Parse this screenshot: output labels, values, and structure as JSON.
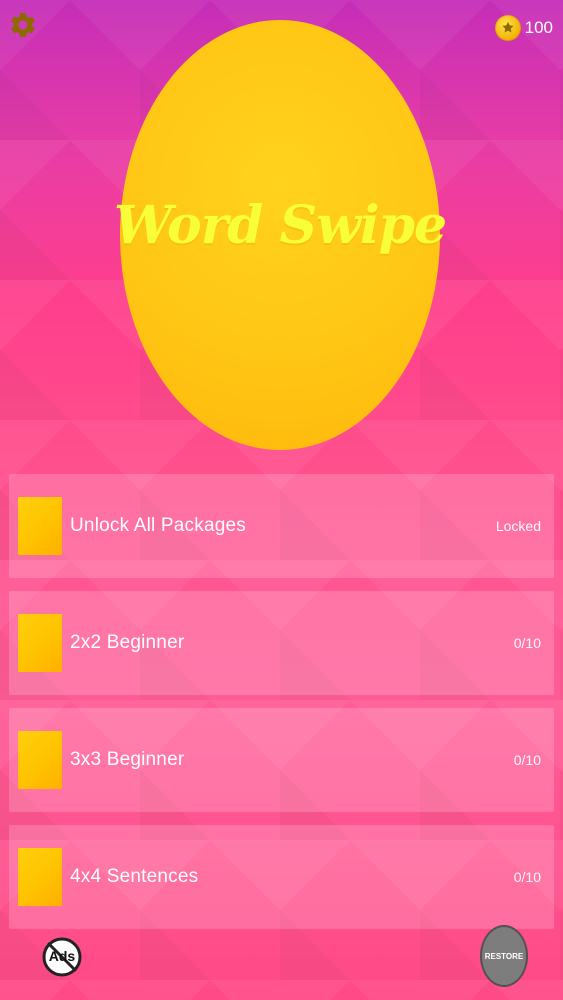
{
  "header": {
    "coins": "100"
  },
  "logo": {
    "title": "Word Swipe"
  },
  "packages": [
    {
      "label": "Unlock All Packages",
      "status": "Locked"
    },
    {
      "label": "2x2 Beginner",
      "status": "0/10"
    },
    {
      "label": "3x3 Beginner",
      "status": "0/10"
    },
    {
      "label": "4x4 Sentences",
      "status": "0/10"
    }
  ],
  "bottom": {
    "ads_label": "Ads",
    "restore_label": "RESTORE"
  },
  "icons": {
    "settings": "gear-icon",
    "coin": "coin-icon",
    "no_ads": "no-ads-icon"
  }
}
